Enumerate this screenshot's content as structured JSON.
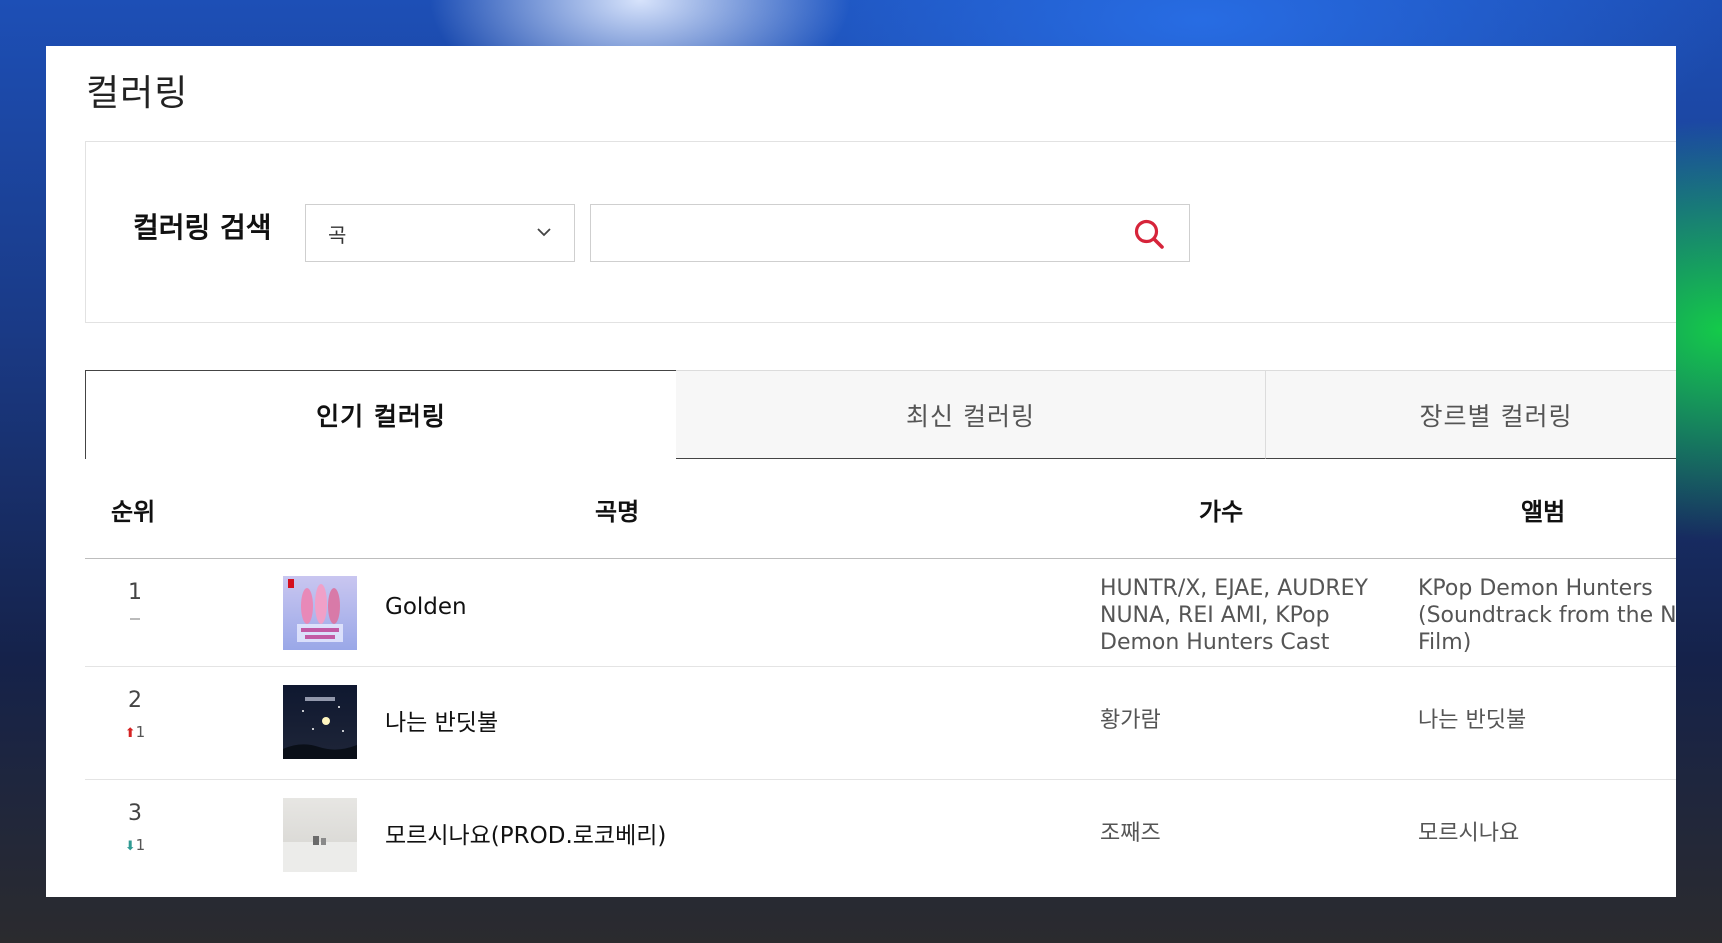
{
  "page": {
    "title": "컬러링"
  },
  "search": {
    "label": "컬러링 검색",
    "category_selected": "곡",
    "query_value": "",
    "query_placeholder": ""
  },
  "tabs": [
    {
      "label": "인기 컬러링",
      "active": true
    },
    {
      "label": "최신 컬러링",
      "active": false
    },
    {
      "label": "장르별 컬러링",
      "active": false
    }
  ],
  "table": {
    "headers": {
      "rank": "순위",
      "song": "곡명",
      "artist": "가수",
      "album": "앨범"
    },
    "rows": [
      {
        "rank": "1",
        "change_dir": "none",
        "change": "",
        "title": "Golden",
        "artist_lines": [
          "HUNTR/X, EJAE, AUDREY",
          "NUNA, REI AMI, KPop",
          "Demon Hunters Cast"
        ],
        "album_lines": [
          "KPop Demon Hunters",
          "(Soundtrack from the Netflix",
          "Film)"
        ]
      },
      {
        "rank": "2",
        "change_dir": "up",
        "change": "1",
        "title": "나는 반딧불",
        "artist_lines": [
          "황가람"
        ],
        "album_lines": [
          "나는 반딧불"
        ]
      },
      {
        "rank": "3",
        "change_dir": "down",
        "change": "1",
        "title": "모르시나요(PROD.로코베리)",
        "artist_lines": [
          "조째즈"
        ],
        "album_lines": [
          "모르시나요"
        ]
      }
    ]
  },
  "colors": {
    "search_icon": "#d6243a",
    "rank_up": "#d52323",
    "rank_down": "#2f9a93"
  }
}
